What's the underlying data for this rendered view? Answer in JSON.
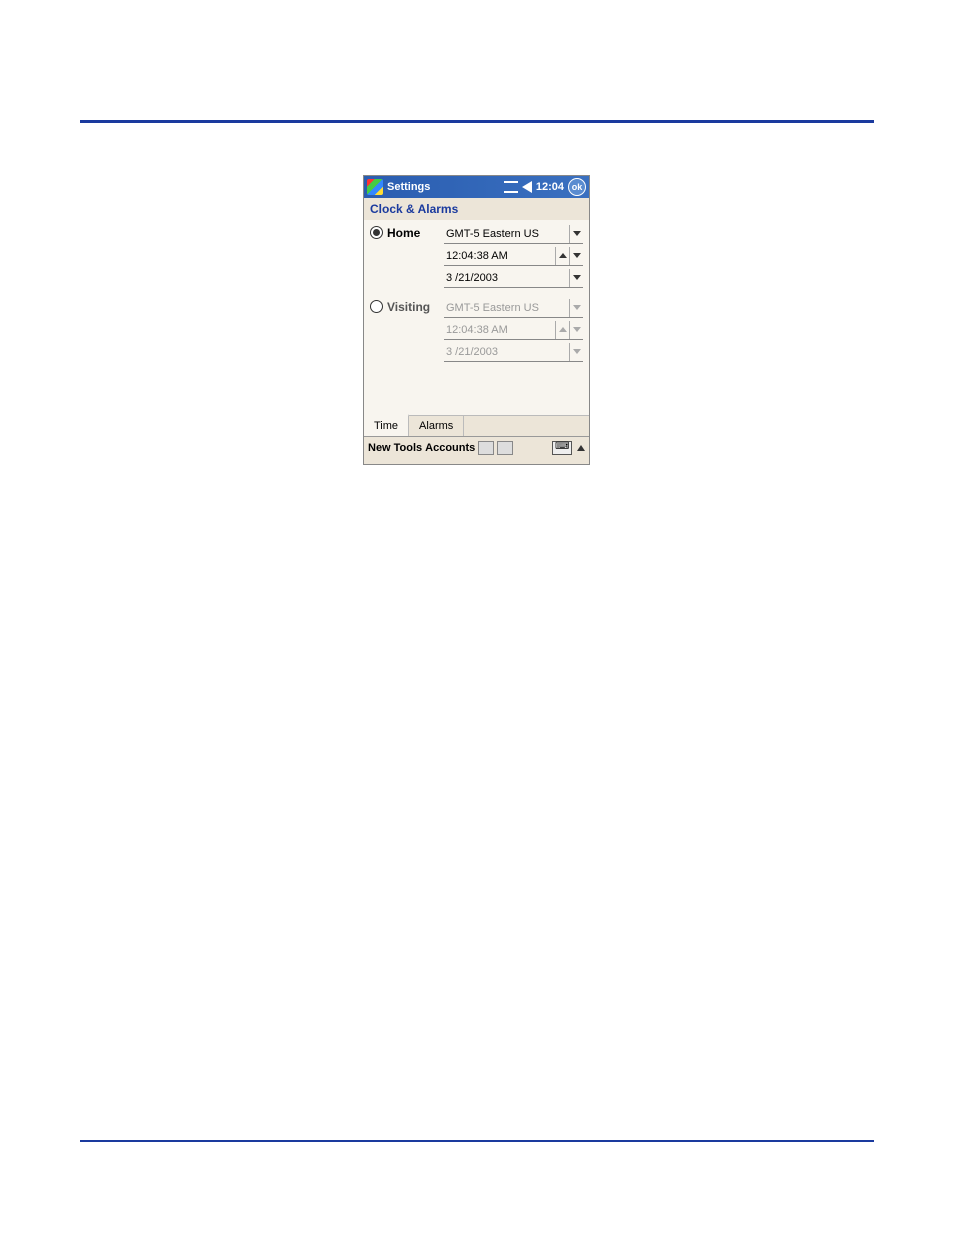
{
  "titlebar": {
    "title": "Settings",
    "time": "12:04",
    "ok": "ok"
  },
  "subtitle": "Clock & Alarms",
  "home": {
    "label": "Home",
    "selected": true,
    "timezone": "GMT-5 Eastern US",
    "time": "12:04:38 AM",
    "date": "3 /21/2003"
  },
  "visiting": {
    "label": "Visiting",
    "selected": false,
    "timezone": "GMT-5 Eastern US",
    "time": "12:04:38 AM",
    "date": "3 /21/2003"
  },
  "tabs": {
    "time": "Time",
    "alarms": "Alarms"
  },
  "bottombar": {
    "new": "New",
    "tools": "Tools",
    "accounts": "Accounts"
  }
}
